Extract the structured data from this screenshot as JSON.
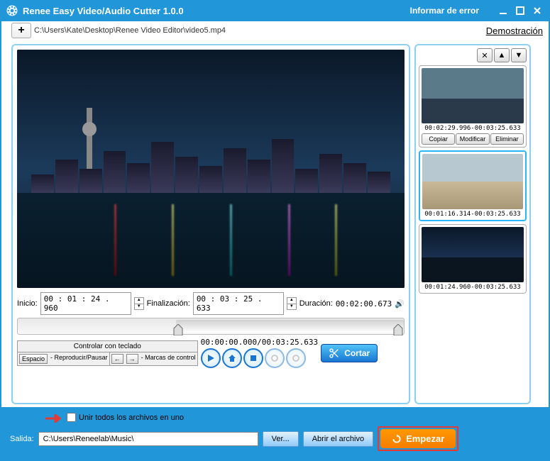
{
  "titlebar": {
    "title": "Renee Easy Video/Audio Cutter 1.0.0",
    "report": "Informar de error"
  },
  "toprow": {
    "filepath": "C:\\Users\\Kate\\Desktop\\Renee Video Editor\\video5.mp4",
    "demo": "Demostración"
  },
  "controls": {
    "start_label": "Inicio:",
    "start_value": "00 : 01 : 24 . 960",
    "end_label": "Finalización:",
    "end_value": "00 : 03 : 25 . 633",
    "duration_label": "Duración:",
    "duration_value": "00:02:00.673",
    "keyboard_header": "Controlar con teclado",
    "key_space": "Espacio",
    "key_space_lbl": "- Reproducir/Pausar",
    "key_arrows_lbl": "- Marcas de control",
    "position_time": "00:00:00.000/00:03:25.633",
    "cut_label": "Cortar"
  },
  "clips": [
    {
      "time": "00:02:29.996-00:03:25.633"
    },
    {
      "time": "00:01:16.314-00:03:25.633"
    },
    {
      "time": "00:01:24.960-00:03:25.633"
    }
  ],
  "clip_actions": {
    "copy": "Copiar",
    "modify": "Modificar",
    "delete": "Eliminar"
  },
  "bottom": {
    "join_label": "Unir todos los archivos en uno",
    "output_label": "Salida:",
    "output_path": "C:\\Users\\Reneelab\\Music\\",
    "browse": "Ver...",
    "open": "Abrir el archivo",
    "start": "Empezar"
  }
}
